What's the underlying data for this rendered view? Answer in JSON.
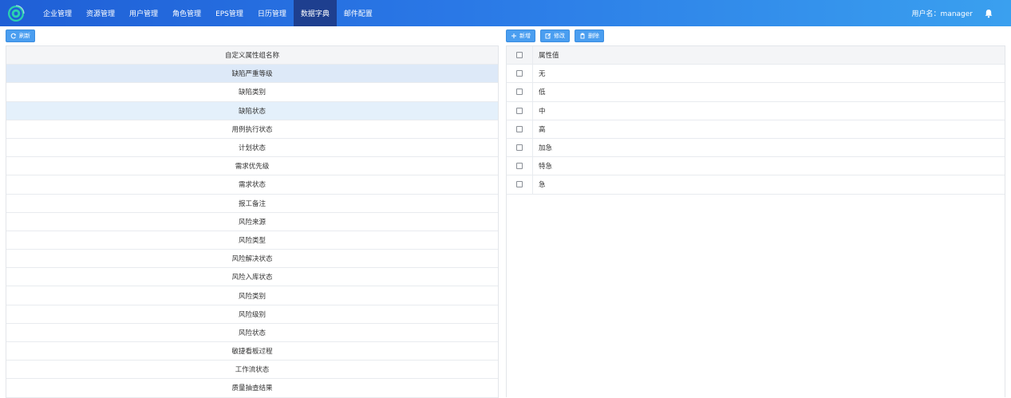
{
  "nav": {
    "items": [
      {
        "label": "企业管理",
        "active": false
      },
      {
        "label": "资源管理",
        "active": false
      },
      {
        "label": "用户管理",
        "active": false
      },
      {
        "label": "角色管理",
        "active": false
      },
      {
        "label": "EPS管理",
        "active": false
      },
      {
        "label": "日历管理",
        "active": false
      },
      {
        "label": "数据字典",
        "active": true
      },
      {
        "label": "邮件配置",
        "active": false
      }
    ],
    "user_label": "用户名：manager",
    "icons": {
      "logo": "logo-icon",
      "bell": "bell-icon"
    }
  },
  "toolbar": {
    "refresh_label": "刷新",
    "add_label": "新增",
    "edit_label": "修改",
    "delete_label": "删除"
  },
  "left_table": {
    "header": "自定义属性组名称",
    "rows": [
      "缺陷严重等级",
      "缺陷类别",
      "缺陷状态",
      "用例执行状态",
      "计划状态",
      "需求优先级",
      "需求状态",
      "报工备注",
      "风险来源",
      "风险类型",
      "风险解决状态",
      "风险入库状态",
      "风险类别",
      "风险级别",
      "风险状态",
      "敏捷看板过程",
      "工作流状态",
      "质量抽查结果"
    ],
    "selected_index": 0,
    "highlight_index": 2
  },
  "right_table": {
    "header": "属性值",
    "rows": [
      "无",
      "低",
      "中",
      "高",
      "加急",
      "特急",
      "急"
    ]
  },
  "colors": {
    "nav_start": "#1f5fd6",
    "nav_end": "#3aa0ef",
    "nav_active": "#1e3f8f",
    "button": "#4a9ef0",
    "row_selected": "#dde9f8"
  }
}
